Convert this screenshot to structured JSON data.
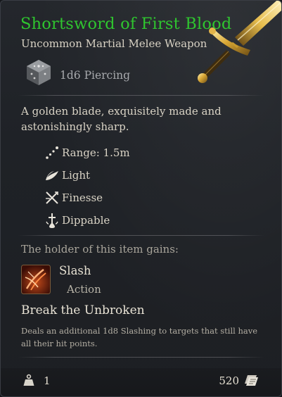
{
  "item": {
    "name": "Shortsword of First Blood",
    "category": "Uncommon Martial Melee Weapon",
    "damage": "1d6 Piercing",
    "description": "A golden blade, exquisitely made and astonishingly sharp.",
    "name_color": "#2fc52f",
    "art_icon": "golden-shortsword-art"
  },
  "properties": [
    {
      "label": "Range: 1.5m",
      "icon": "range-icon"
    },
    {
      "label": "Light",
      "icon": "feather-icon"
    },
    {
      "label": "Finesse",
      "icon": "finesse-icon"
    },
    {
      "label": "Dippable",
      "icon": "dippable-icon"
    }
  ],
  "gains": {
    "header": "The holder of this item gains:",
    "action": {
      "name": "Slash",
      "type": "Action",
      "icon": "slash-action-icon"
    },
    "passive": {
      "name": "Break the Unbroken",
      "description": "Deals an additional 1d8 Slashing to targets that still have all their hit points."
    }
  },
  "footer": {
    "weight": "1",
    "value": "520",
    "weight_icon": "weight-icon",
    "value_icon": "gold-coin-icon"
  }
}
